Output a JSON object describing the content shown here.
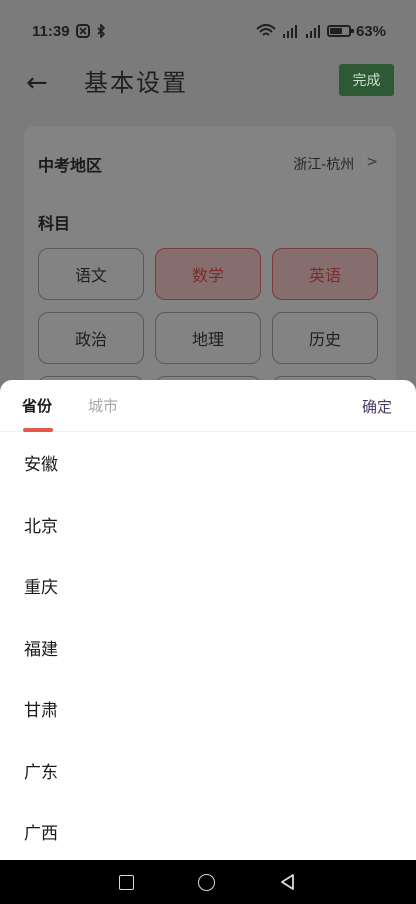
{
  "status_bar": {
    "time": "11:39",
    "left_icons": [
      "nfc-icon",
      "bluetooth-icon"
    ],
    "battery_percent": "63%"
  },
  "header": {
    "back_icon": "←",
    "title": "基本设置",
    "done_label": "完成"
  },
  "settings": {
    "region_label": "中考地区",
    "region_value": "浙江-杭州",
    "region_chevron": ">",
    "subject_label": "科目",
    "subjects": [
      {
        "label": "语文",
        "selected": false
      },
      {
        "label": "数学",
        "selected": true
      },
      {
        "label": "英语",
        "selected": true
      },
      {
        "label": "政治",
        "selected": false
      },
      {
        "label": "地理",
        "selected": false
      },
      {
        "label": "历史",
        "selected": false
      }
    ]
  },
  "picker": {
    "tab_province": "省份",
    "tab_city": "城市",
    "confirm_label": "确定",
    "provinces": [
      "安徽",
      "北京",
      "重庆",
      "福建",
      "甘肃",
      "广东",
      "广西"
    ]
  },
  "colors": {
    "accent_red": "#e7584a",
    "done_green": "#2d5a35",
    "confirm_purple": "#4a3b66"
  }
}
